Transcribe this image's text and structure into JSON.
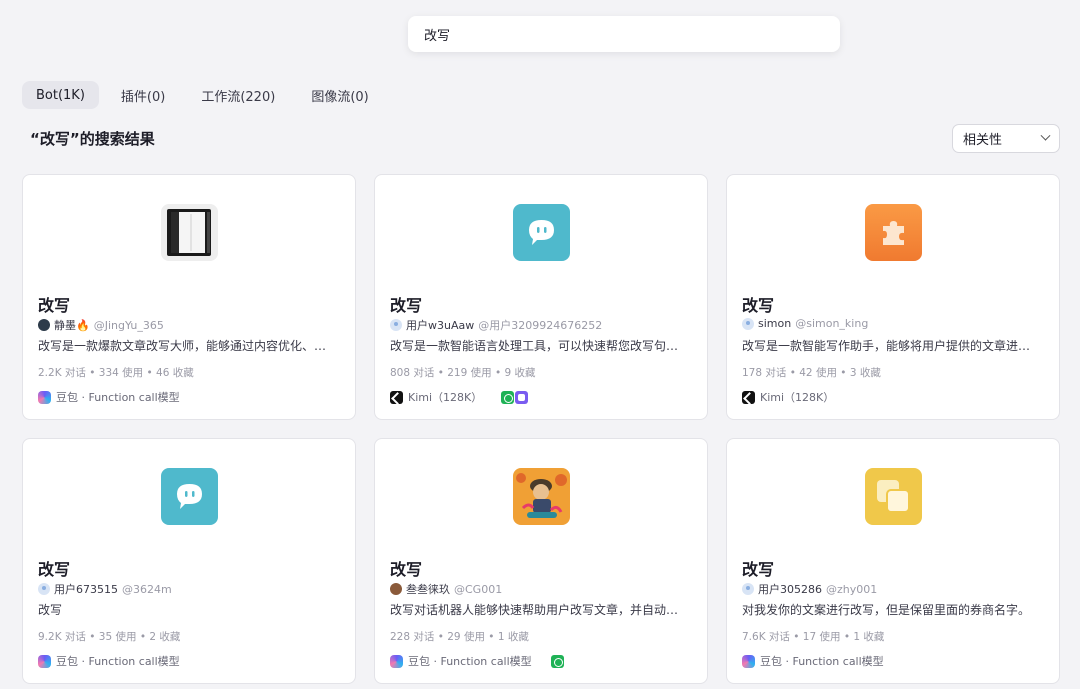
{
  "search": {
    "value": "改写"
  },
  "tabs": [
    {
      "label": "Bot(1K)",
      "active": true
    },
    {
      "label": "插件(0)",
      "active": false
    },
    {
      "label": "工作流(220)",
      "active": false
    },
    {
      "label": "图像流(0)",
      "active": false
    }
  ],
  "results_title": "“改写”的搜索结果",
  "sort": {
    "selected": "相关性"
  },
  "cards": [
    {
      "title": "改写",
      "author": "静墨🔥",
      "handle": "@JingYu_365",
      "description": "改写是一款爆款文章改写大师，能够通过内容优化、…",
      "stats": "2.2K 对话 • 334 使用 • 46 收藏",
      "model": "豆包 · Function call模型",
      "model_logo": "doubao",
      "plugins": [],
      "icon": "notebook-icon"
    },
    {
      "title": "改写",
      "author": "用户w3uAaw",
      "handle": "@用户3209924676252",
      "description": "改写是一款智能语言处理工具，可以快速帮您改写句…",
      "stats": "808 对话 • 219 使用 • 9 收藏",
      "model": "Kimi（128K）",
      "model_logo": "kimi",
      "plugins": [
        "green",
        "purple"
      ],
      "icon": "chat-bubble-icon"
    },
    {
      "title": "改写",
      "author": "simon",
      "handle": "@simon_king",
      "description": "改写是一款智能写作助手，能够将用户提供的文章进…",
      "stats": "178 对话 • 42 使用 • 3 收藏",
      "model": "Kimi（128K）",
      "model_logo": "kimi",
      "plugins": [],
      "icon": "puzzle-icon"
    },
    {
      "title": "改写",
      "author": "用户673515",
      "handle": "@3624m",
      "description": "改写",
      "stats": "9.2K 对话 • 35 使用 • 2 收藏",
      "model": "豆包 · Function call模型",
      "model_logo": "doubao",
      "plugins": [],
      "icon": "chat-bubble-icon"
    },
    {
      "title": "改写",
      "author": "叁叁徕玖",
      "handle": "@CG001",
      "description": "改写对话机器人能够快速帮助用户改写文章，并自动…",
      "stats": "228 对话 • 29 使用 • 1 收藏",
      "model": "豆包 · Function call模型",
      "model_logo": "doubao",
      "plugins": [
        "green"
      ],
      "icon": "character-illustration-icon"
    },
    {
      "title": "改写",
      "author": "用户305286",
      "handle": "@zhy001",
      "description": "对我发你的文案进行改写，但是保留里面的券商名字。",
      "stats": "7.6K 对话 • 17 使用 • 1 收藏",
      "model": "豆包 · Function call模型",
      "model_logo": "doubao",
      "plugins": [],
      "icon": "copy-squares-icon"
    }
  ],
  "colors": {
    "background": "#f3f3f6",
    "card": "#ffffff",
    "chat_icon": "#4fb9cc",
    "puzzle_icon": "#f58a3c",
    "copy_icon": "#f0c84a"
  }
}
